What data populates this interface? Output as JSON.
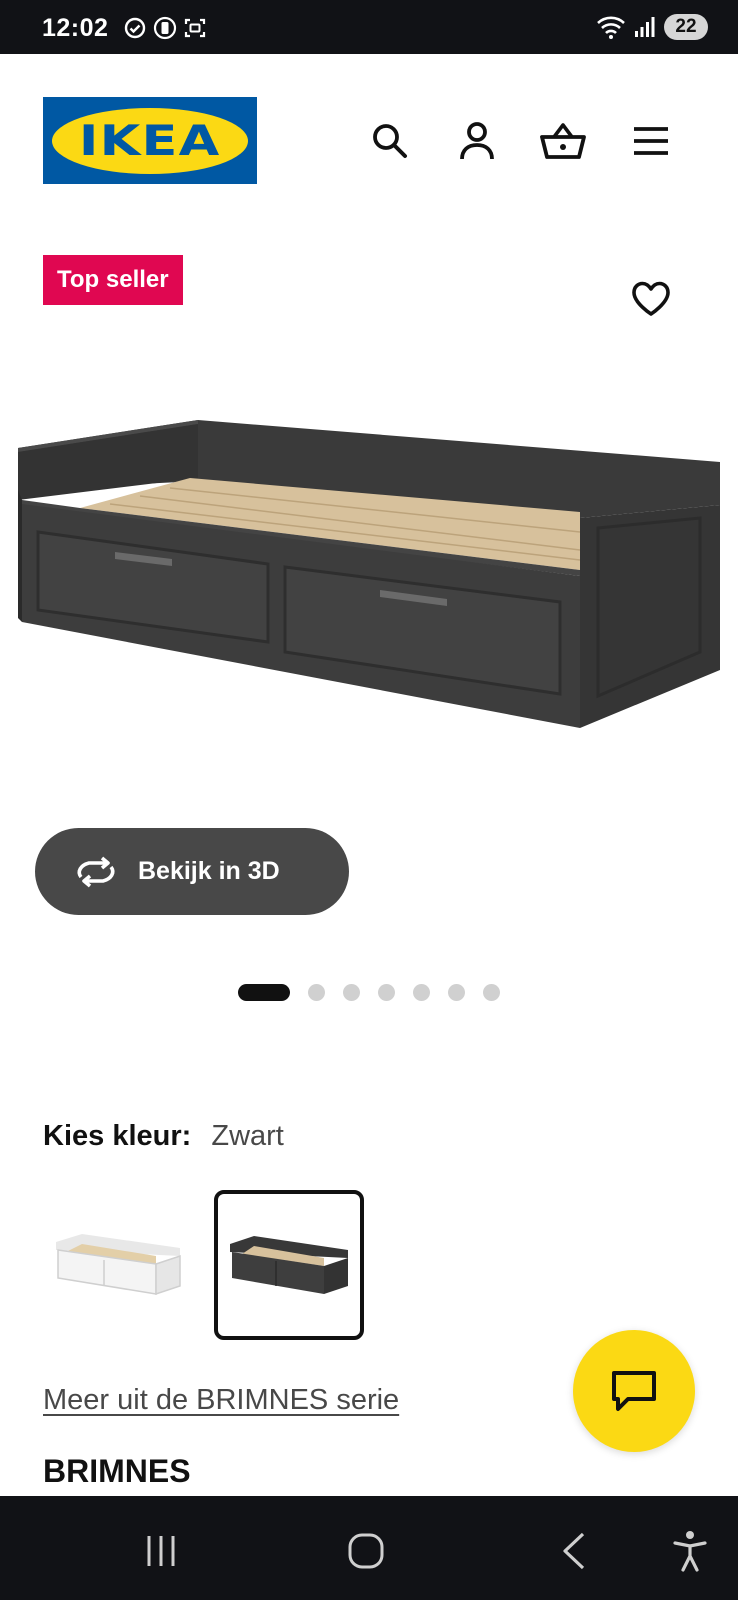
{
  "status_bar": {
    "time": "12:02",
    "battery": "22"
  },
  "header": {
    "logo_text": "IKEA",
    "icons": [
      "search-icon",
      "account-icon",
      "basket-icon",
      "menu-icon"
    ]
  },
  "product": {
    "badge": "Top seller",
    "view_3d_label": "Bekijk in 3D",
    "gallery": {
      "current": 1,
      "total": 7
    },
    "color_label": "Kies kleur:",
    "color_value": "Zwart",
    "color_options": [
      "white",
      "black"
    ],
    "selected_color_index": 1,
    "series_link": "Meer uit de BRIMNES serie",
    "name": "BRIMNES"
  },
  "colors": {
    "ikea_blue": "#0058a3",
    "ikea_yellow": "#fbd914",
    "badge_red": "#e00751",
    "button_dark": "#484848"
  }
}
